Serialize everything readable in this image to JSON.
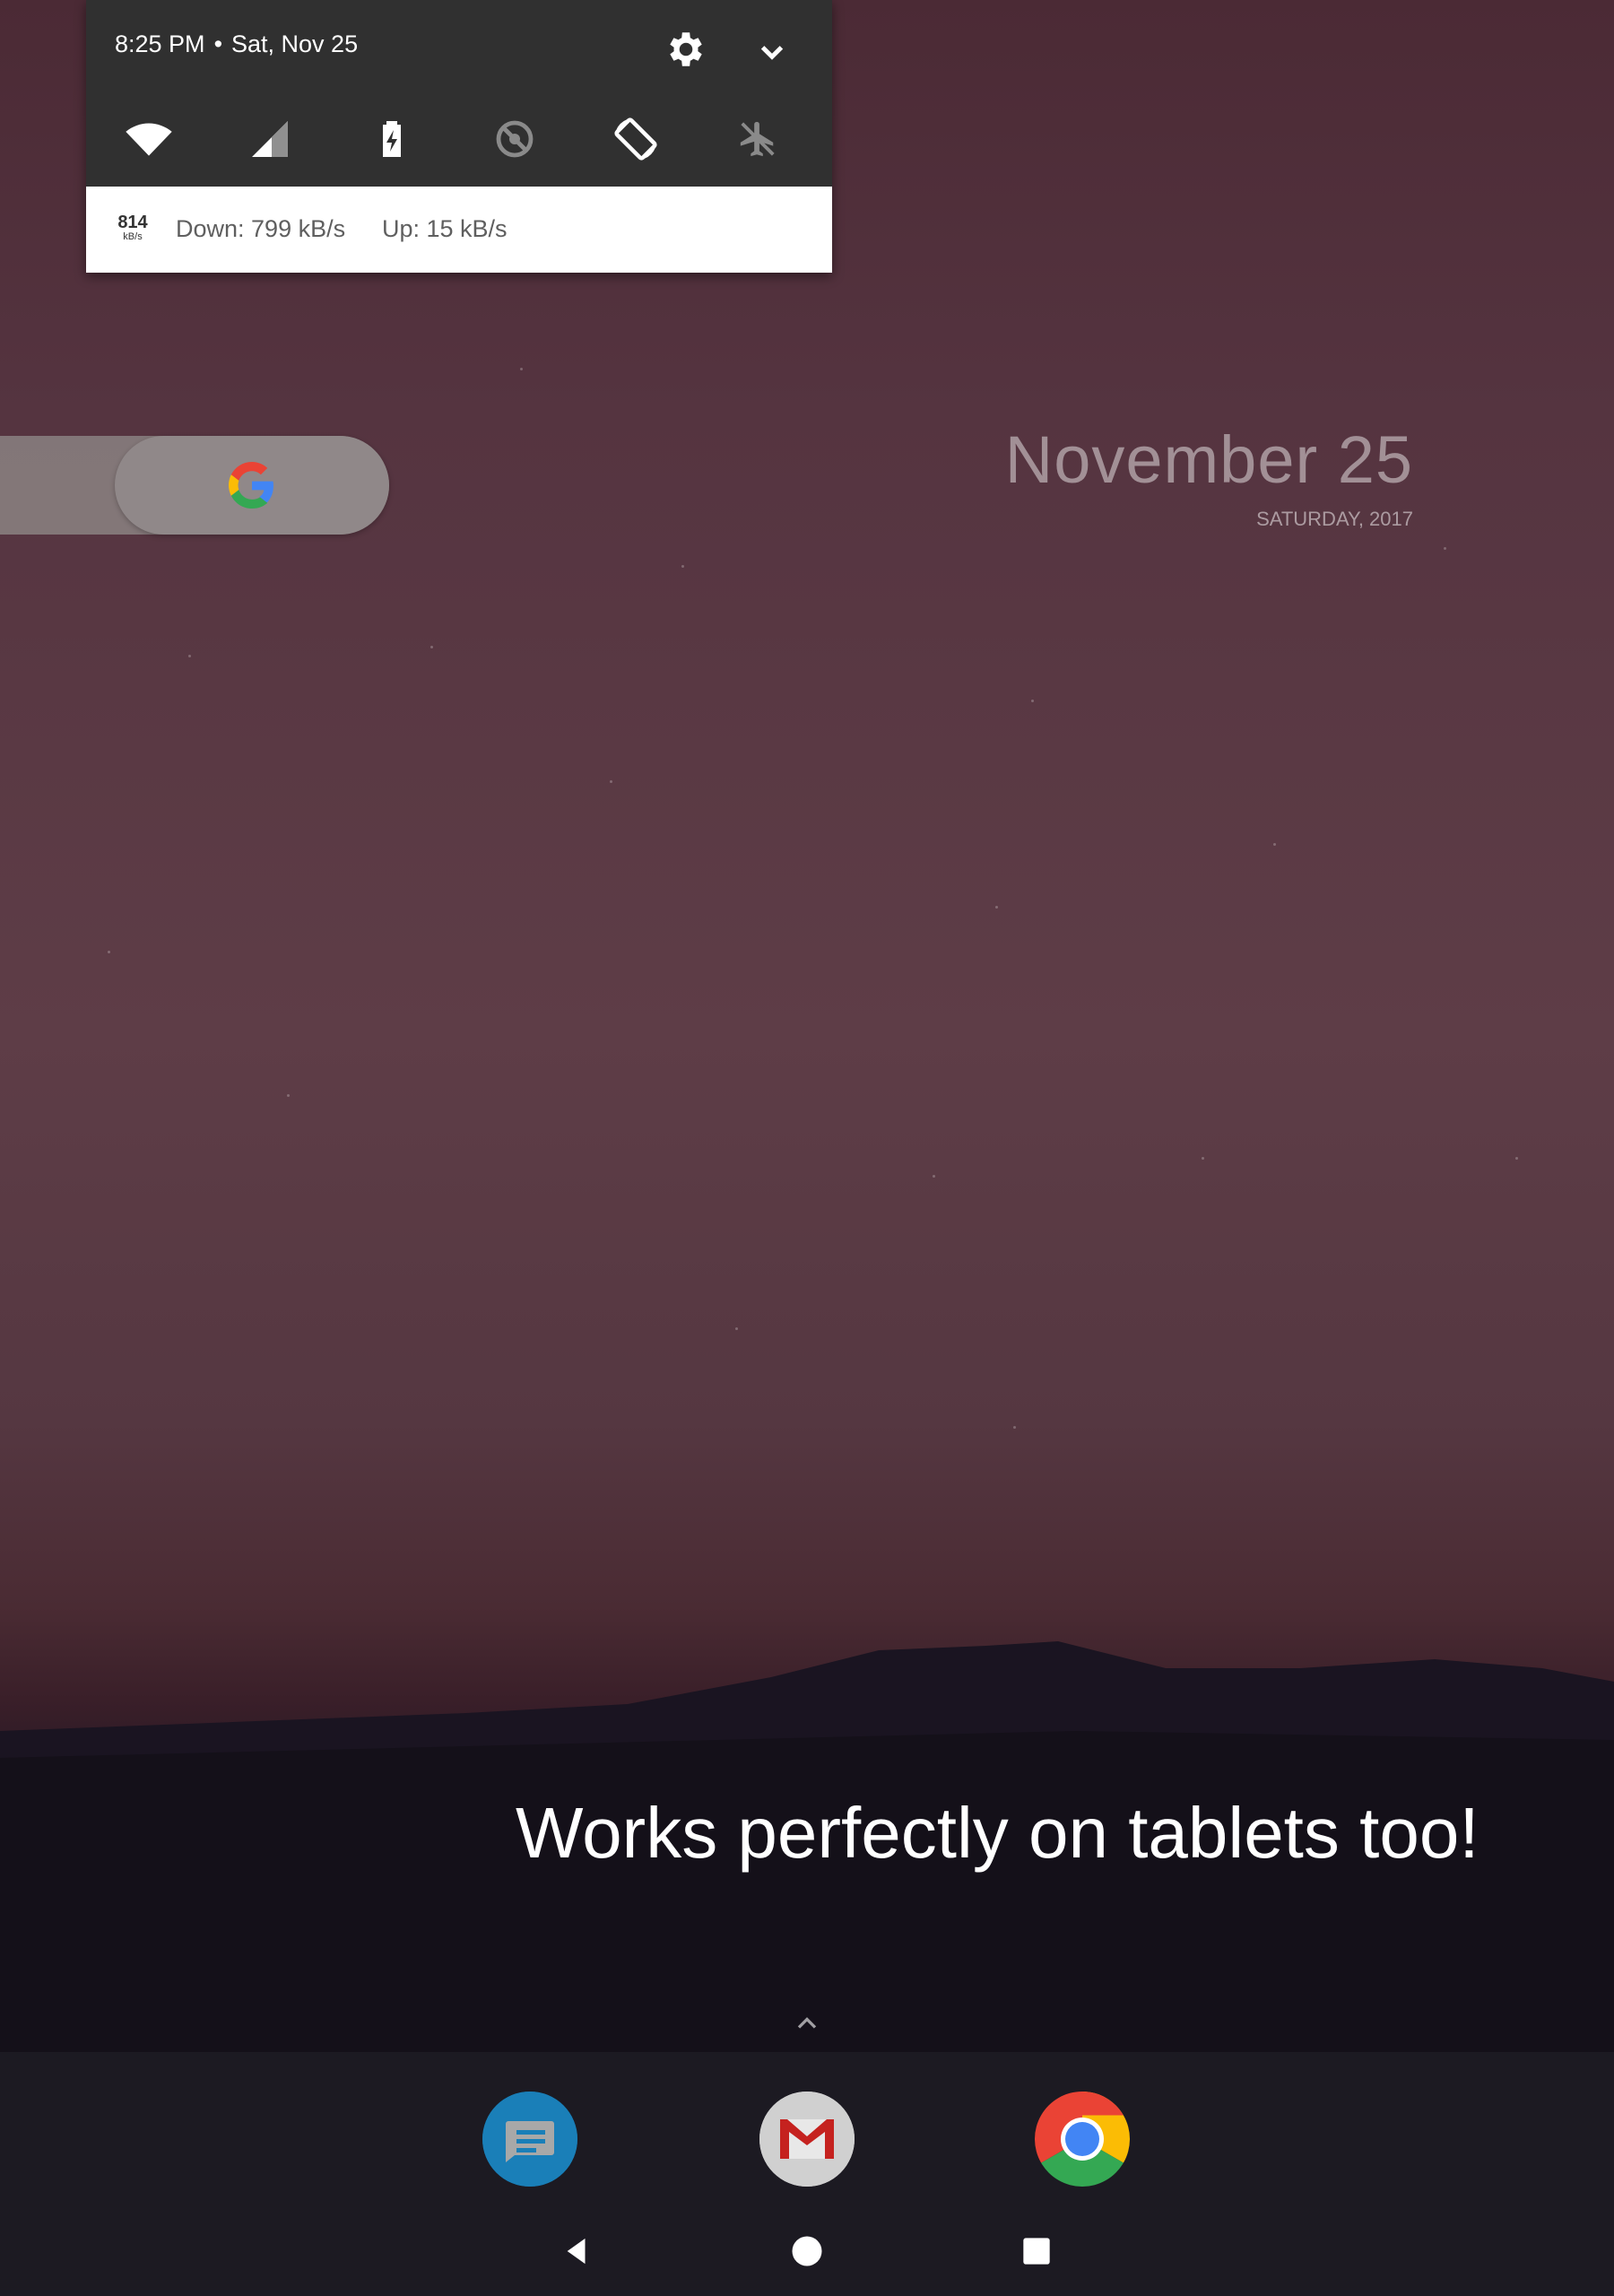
{
  "status_shade": {
    "time": "8:25 PM",
    "separator": "•",
    "date": "Sat, Nov 25",
    "settings_icon": "gear-icon",
    "expand_icon": "chevron-down-icon",
    "quick_settings": [
      {
        "id": "wifi",
        "icon": "wifi-icon"
      },
      {
        "id": "cellular",
        "icon": "cellular-signal-icon"
      },
      {
        "id": "battery",
        "icon": "battery-charging-icon"
      },
      {
        "id": "data-saver",
        "icon": "data-saver-off-icon"
      },
      {
        "id": "auto-rotate",
        "icon": "auto-rotate-icon"
      },
      {
        "id": "airplane",
        "icon": "airplane-mode-icon"
      }
    ],
    "notification": {
      "speed_value": "814",
      "speed_unit": "kB/s",
      "down": "Down: 799 kB/s",
      "up": "Up: 15 kB/s"
    }
  },
  "search_widget": {
    "icon": "google-g-icon"
  },
  "date_widget": {
    "date": "November 25",
    "weekday_year": "SATURDAY, 2017"
  },
  "caption": "Works perfectly on tablets too!",
  "dock": {
    "apps": [
      {
        "name": "Messages",
        "icon": "messages-icon"
      },
      {
        "name": "Gmail",
        "icon": "gmail-icon"
      },
      {
        "name": "Chrome",
        "icon": "chrome-icon"
      }
    ]
  },
  "navigation": {
    "back_icon": "back-triangle-icon",
    "home_icon": "home-circle-icon",
    "recents_icon": "recents-square-icon"
  },
  "colors": {
    "shade_header": "#303030",
    "shade_notification": "#ffffff",
    "dock": "#1c1a22"
  }
}
